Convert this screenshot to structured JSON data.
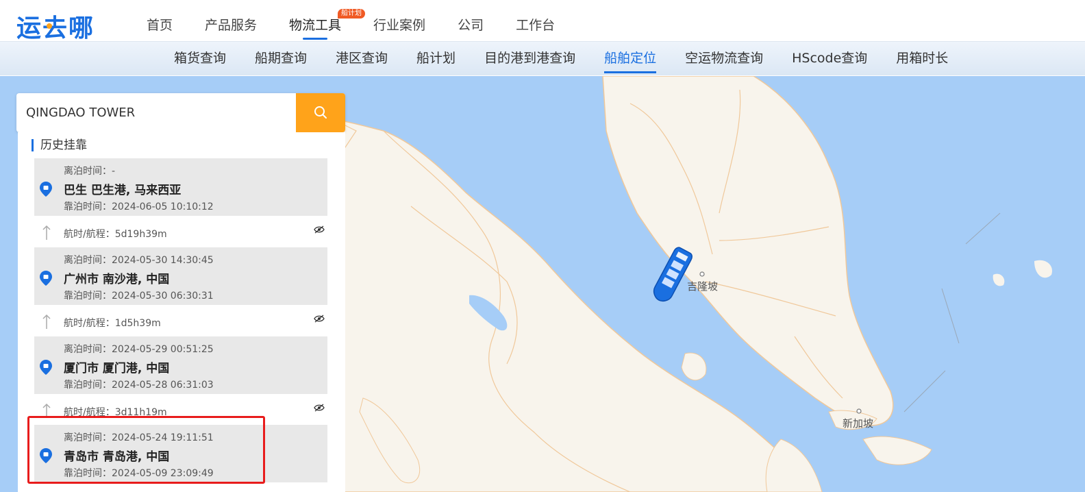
{
  "header": {
    "logo": "运去哪",
    "nav": [
      {
        "label": "首页"
      },
      {
        "label": "产品服务"
      },
      {
        "label": "物流工具",
        "badge": "船计划",
        "active": true
      },
      {
        "label": "行业案例"
      },
      {
        "label": "公司"
      },
      {
        "label": "工作台"
      }
    ]
  },
  "subnav": [
    {
      "label": "箱货查询"
    },
    {
      "label": "船期查询"
    },
    {
      "label": "港区查询"
    },
    {
      "label": "船计划"
    },
    {
      "label": "目的港到港查询"
    },
    {
      "label": "船舶定位",
      "active": true
    },
    {
      "label": "空运物流查询"
    },
    {
      "label": "HScode查询"
    },
    {
      "label": "用箱时长"
    }
  ],
  "search": {
    "value": "QINGDAO TOWER",
    "button_icon": "search-icon"
  },
  "history": {
    "title": "历史挂靠",
    "ports": [
      {
        "depart": "离泊时间：-",
        "name": "巴生 巴生港, 马来西亚",
        "arrive": "靠泊时间：2024-06-05 10:10:12"
      },
      {
        "depart": "离泊时间：2024-05-30 14:30:45",
        "name": "广州市 南沙港, 中国",
        "arrive": "靠泊时间：2024-05-30 06:30:31"
      },
      {
        "depart": "离泊时间：2024-05-29 00:51:25",
        "name": "厦门市 厦门港, 中国",
        "arrive": "靠泊时间：2024-05-28 06:31:03"
      },
      {
        "depart": "离泊时间：2024-05-24 19:11:51",
        "name": "青岛市 青岛港, 中国",
        "arrive": "靠泊时间：2024-05-09 23:09:49"
      }
    ],
    "legs": [
      {
        "text": "航时/航程：5d19h39m"
      },
      {
        "text": "航时/航程：1d5h39m"
      },
      {
        "text": "航时/航程：3d11h19m"
      }
    ]
  },
  "map": {
    "labels": {
      "kuala_lumpur": "吉隆坡",
      "singapore": "新加坡"
    },
    "colors": {
      "sea": "#a6cdf7",
      "land": "#f8f4ec",
      "border": "#f0c89a"
    }
  },
  "colors": {
    "accent": "#1a6fe0",
    "search_button": "#ffa31a",
    "highlight": "#e81c1c"
  }
}
